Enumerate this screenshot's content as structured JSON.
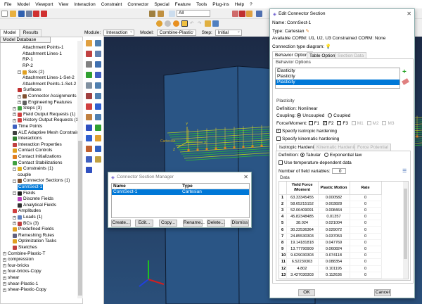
{
  "menu": [
    "File",
    "Model",
    "Viewport",
    "View",
    "Interaction",
    "Constraint",
    "Connector",
    "Special",
    "Feature",
    "Tools",
    "Plug-ins",
    "Help",
    "?"
  ],
  "toolbar": {
    "selection_filter": "All"
  },
  "context": {
    "module_label": "Module:",
    "module": "Interaction",
    "model_label": "Model:",
    "model": "Combine-Plastic",
    "step_label": "Step:",
    "step": "Initial"
  },
  "left_tabs": [
    "Model",
    "Results"
  ],
  "tree_combo": "Model Database",
  "tree": [
    {
      "label": "Attachment Points-1",
      "indent": 4
    },
    {
      "label": "Attachment Lines-1",
      "indent": 4
    },
    {
      "label": "RP-1",
      "indent": 4
    },
    {
      "label": "RP-2",
      "indent": 4
    },
    {
      "label": "Sets (2)",
      "indent": 3,
      "pm": "−",
      "color": "#e0a020"
    },
    {
      "label": "Attachment Lines-1-Set-2",
      "indent": 4
    },
    {
      "label": "Attachment Points-1-Set-2",
      "indent": 4
    },
    {
      "label": "Surfaces",
      "indent": 3,
      "color": "#c03030"
    },
    {
      "label": "Connector Assignments (1)",
      "indent": 3,
      "pm": "+",
      "color": "#805030"
    },
    {
      "label": "Engineering Features",
      "indent": 3,
      "pm": "+",
      "color": "#606060"
    },
    {
      "label": "Steps (3)",
      "indent": 2,
      "pm": "+",
      "color": "#40a040"
    },
    {
      "label": "Field Output Requests (1)",
      "indent": 2,
      "pm": "+",
      "color": "#d04040"
    },
    {
      "label": "History Output Requests (1)",
      "indent": 2,
      "pm": "+",
      "color": "#d04040"
    },
    {
      "label": "Time Points",
      "indent": 2,
      "color": "#4060c0"
    },
    {
      "label": "ALE Adaptive Mesh Constraints",
      "indent": 2,
      "color": "#404040"
    },
    {
      "label": "Interactions",
      "indent": 2,
      "color": "#308030"
    },
    {
      "label": "Interaction Properties",
      "indent": 2,
      "color": "#c04040"
    },
    {
      "label": "Contact Controls",
      "indent": 2,
      "color": "#e0a020"
    },
    {
      "label": "Contact Initializations",
      "indent": 2,
      "color": "#e08020"
    },
    {
      "label": "Contact Stabilizations",
      "indent": 2,
      "color": "#40a040"
    },
    {
      "label": "Constraints (1)",
      "indent": 2,
      "pm": "−",
      "color": "#e0b020"
    },
    {
      "label": "couple",
      "indent": 3
    },
    {
      "label": "Connector Sections (1)",
      "indent": 2,
      "pm": "−",
      "color": "#805030"
    },
    {
      "label": "ConnSect-1",
      "indent": 3,
      "selected": true
    },
    {
      "label": "Fields",
      "indent": 2,
      "pm": "−",
      "color": "#202020"
    },
    {
      "label": "Discrete Fields",
      "indent": 3,
      "color": "#c040c0"
    },
    {
      "label": "Analytical Fields",
      "indent": 3,
      "color": "#303030"
    },
    {
      "label": "Amplitudes",
      "indent": 2,
      "color": "#d04040"
    },
    {
      "label": "Loads (1)",
      "indent": 2,
      "pm": "+",
      "color": "#6080c0"
    },
    {
      "label": "BCs (3)",
      "indent": 2,
      "pm": "+",
      "color": "#c04040"
    },
    {
      "label": "Predefined Fields",
      "indent": 2,
      "color": "#e0a020"
    },
    {
      "label": "Remeshing Rules",
      "indent": 2,
      "color": "#606080"
    },
    {
      "label": "Optimization Tasks",
      "indent": 2,
      "color": "#e0a020"
    },
    {
      "label": "Sketches",
      "indent": 2,
      "color": "#c04040"
    },
    {
      "label": "Combine-Plastic-T",
      "indent": 0,
      "pm": "+"
    },
    {
      "label": "compression",
      "indent": 0,
      "pm": "+"
    },
    {
      "label": "four-bricks",
      "indent": 0,
      "pm": "+"
    },
    {
      "label": "four-bricks-Copy",
      "indent": 0,
      "pm": "+"
    },
    {
      "label": "shear",
      "indent": 0,
      "pm": "+"
    },
    {
      "label": "shear-Plastic-1",
      "indent": 0,
      "pm": "+"
    },
    {
      "label": "shear-Plastic-Copy",
      "indent": 0,
      "pm": "+"
    }
  ],
  "viewport": {
    "triad": {
      "x": "X",
      "y": "Y",
      "z": "Z"
    },
    "label": "Cartesian"
  },
  "manager": {
    "title": "Connector Section Manager",
    "columns": [
      "Name",
      "Type"
    ],
    "rows": [
      {
        "name": "ConnSect-1",
        "type": "Cartesian"
      }
    ],
    "buttons": [
      "Create...",
      "Edit...",
      "Copy...",
      "Rename...",
      "Delete...",
      "Dismiss"
    ]
  },
  "editor": {
    "title": "Edit Connector Section",
    "name_label": "Name:",
    "name": "ConnSect-1",
    "type_label": "Type:",
    "type": "Cartesian",
    "corm": "Available CORM:  U1, U2, U3   Constrained CORM:  None",
    "diagram_label": "Connection type diagram:",
    "tabs": [
      "Behavior Options",
      "Table Options",
      "Section Data"
    ],
    "behavior_group": "Behavior Options",
    "behaviors": [
      "Elasticity",
      "Plasticity",
      "Plasticity"
    ],
    "plasticity_group": "Plasticity",
    "definition": "Definition:  Nonlinear",
    "coupling_label": "Coupling:",
    "coupling_options": [
      "Uncoupled",
      "Coupled"
    ],
    "force_label": "Force/Moment:",
    "force_options": [
      "F1",
      "F2",
      "F3",
      "M1",
      "M2",
      "M3"
    ],
    "iso_label": "Specify isotropic hardening",
    "kin_label": "Specify kinematic hardening",
    "sub_tabs": [
      "Isotropic Hardening",
      "Kinematic Hardening",
      "Force Potential"
    ],
    "def_label": "Definition:",
    "def_options": [
      "Tabular",
      "Exponential law"
    ],
    "temp_label": "Use temperature-dependent data",
    "fieldvars_label": "Number of field variables:",
    "fieldvars": "0",
    "data_group": "Data",
    "columns": [
      "Yield Force /Moment",
      "Plastic Motion",
      "Rate"
    ],
    "rows": [
      [
        "1",
        "63.33345455",
        "0.000582",
        "0"
      ],
      [
        "2",
        "58.65215152",
        "0.003828",
        "0"
      ],
      [
        "3",
        "52.06409091",
        "0.008464",
        "0"
      ],
      [
        "4",
        "45.82348485",
        "0.01357",
        "0"
      ],
      [
        "5",
        "38.024",
        "0.021004",
        "0"
      ],
      [
        "6",
        "30.22536364",
        "0.029072",
        "0"
      ],
      [
        "7",
        "24.85530303",
        "0.037053",
        "0"
      ],
      [
        "8",
        "19.14181818",
        "0.047769",
        "0"
      ],
      [
        "9",
        "13.77790909",
        "0.060824",
        "0"
      ],
      [
        "10",
        "9.629030303",
        "0.074118",
        "0"
      ],
      [
        "11",
        "6.52230303",
        "0.088354",
        "0"
      ],
      [
        "12",
        "4.802",
        "0.101195",
        "0"
      ],
      [
        "13",
        "3.427030303",
        "0.112636",
        "0"
      ]
    ],
    "ok": "OK",
    "cancel": "Cancel"
  }
}
